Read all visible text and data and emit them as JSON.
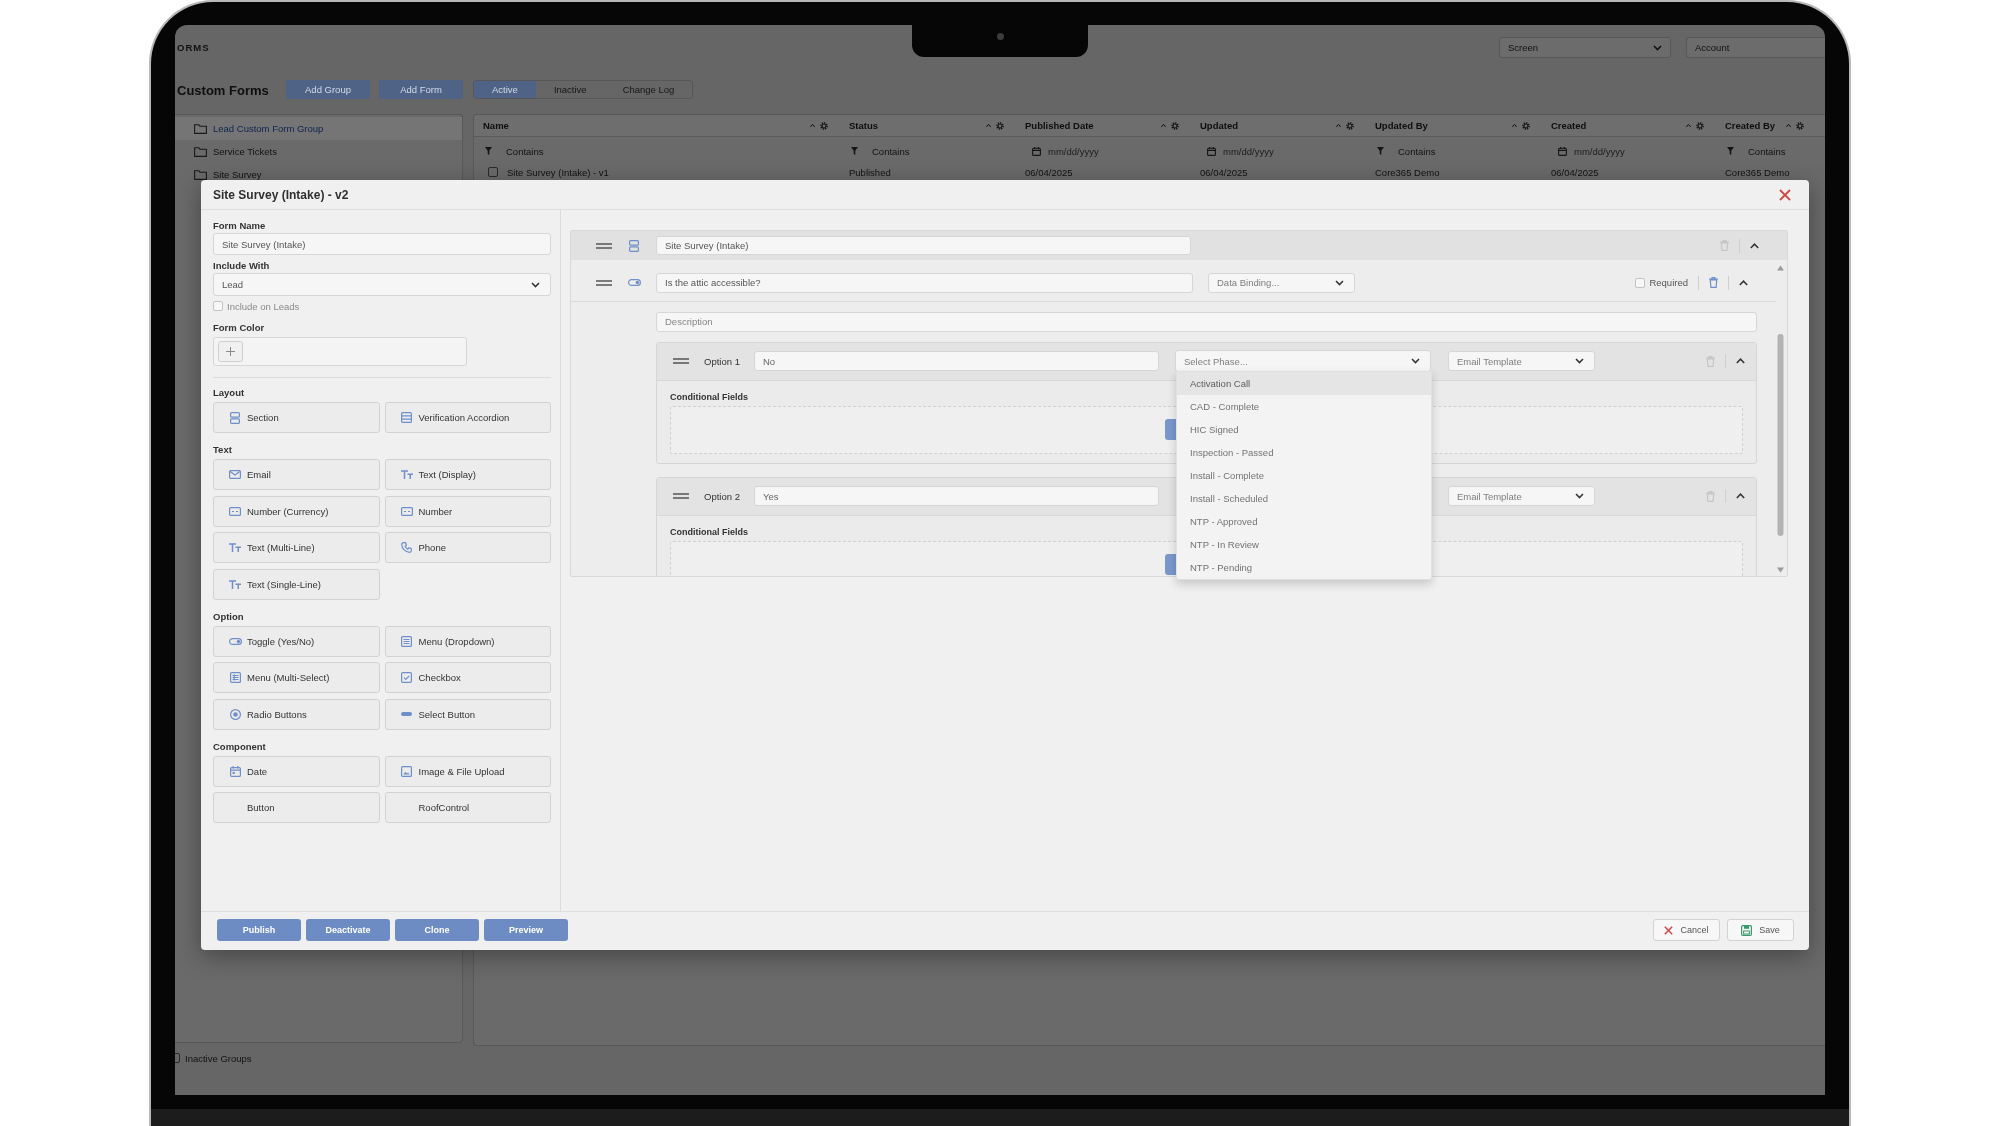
{
  "background_app": {
    "header": {
      "title": "ORMS",
      "screen_select": {
        "value": "Screen"
      },
      "account_field": {
        "placeholder": "Account"
      }
    },
    "page_title": "Custom Forms",
    "actions": [
      "Add Group",
      "Add Form"
    ],
    "tabs": [
      {
        "label": "Active",
        "selected": true
      },
      {
        "label": "Inactive",
        "selected": false
      },
      {
        "label": "Change Log",
        "selected": false
      }
    ],
    "sidebar": {
      "groups": [
        {
          "label": "Lead Custom Form Group",
          "selected": true
        },
        {
          "label": "Service Tickets",
          "selected": false
        },
        {
          "label": "Site Survey",
          "selected": false
        }
      ],
      "inactive_groups": {
        "label": "Inactive Groups",
        "checked": false
      }
    },
    "table": {
      "columns": [
        {
          "label": "Name",
          "filter": {
            "kind": "text",
            "placeholder": "Contains"
          }
        },
        {
          "label": "Status",
          "filter": {
            "kind": "text",
            "placeholder": "Contains"
          }
        },
        {
          "label": "Published Date",
          "filter": {
            "kind": "date",
            "placeholder": "mm/dd/yyyy"
          }
        },
        {
          "label": "Updated",
          "filter": {
            "kind": "date",
            "placeholder": "mm/dd/yyyy"
          }
        },
        {
          "label": "Updated By",
          "filter": {
            "kind": "text",
            "placeholder": "Contains"
          }
        },
        {
          "label": "Created",
          "filter": {
            "kind": "date",
            "placeholder": "mm/dd/yyyy"
          }
        },
        {
          "label": "Created By",
          "filter": {
            "kind": "text",
            "placeholder": "Contains"
          }
        }
      ],
      "rows": [
        {
          "checked": false,
          "cells": [
            "Site Survey (Intake) - v1",
            "Published",
            "06/04/2025",
            "06/04/2025",
            "Core365 Demo",
            "06/04/2025",
            "Core365 Demo"
          ]
        }
      ]
    }
  },
  "dialog": {
    "title": "Site Survey (Intake) - v2",
    "form_name": {
      "label": "Form Name",
      "value": "Site Survey (Intake)"
    },
    "include_with": {
      "label": "Include With",
      "value": "Lead"
    },
    "include_on_leads": {
      "label": "Include on Leads",
      "checked": false,
      "disabled": true
    },
    "form_color": {
      "label": "Form Color"
    },
    "palette": [
      {
        "heading": "Layout",
        "items": [
          {
            "label": "Section",
            "kind": "section"
          },
          {
            "label": "Verification Accordion",
            "kind": "accordion"
          }
        ]
      },
      {
        "heading": "Text",
        "items": [
          {
            "label": "Email",
            "kind": "email"
          },
          {
            "label": "Text (Display)",
            "kind": "text"
          },
          {
            "label": "Number (Currency)",
            "kind": "currency"
          },
          {
            "label": "Number",
            "kind": "number"
          },
          {
            "label": "Text (Multi-Line)",
            "kind": "text"
          },
          {
            "label": "Phone",
            "kind": "phone"
          },
          {
            "label": "Text (Single-Line)",
            "kind": "text"
          }
        ]
      },
      {
        "heading": "Option",
        "items": [
          {
            "label": "Toggle (Yes/No)",
            "kind": "toggle"
          },
          {
            "label": "Menu (Dropdown)",
            "kind": "dropdown"
          },
          {
            "label": "Menu (Multi-Select)",
            "kind": "multiselect"
          },
          {
            "label": "Checkbox",
            "kind": "checkbox"
          },
          {
            "label": "Radio Buttons",
            "kind": "radio"
          },
          {
            "label": "Select Button",
            "kind": "select_button"
          }
        ]
      },
      {
        "heading": "Component",
        "items": [
          {
            "label": "Date",
            "kind": "date"
          },
          {
            "label": "Image & File Upload",
            "kind": "upload"
          },
          {
            "label": "Button",
            "kind": "button"
          },
          {
            "label": "RoofControl",
            "kind": "roof"
          }
        ]
      }
    ],
    "builder": {
      "section": {
        "title": "Site Survey (Intake)",
        "can_delete": false,
        "expanded": true
      },
      "field": {
        "kind": "toggle",
        "question": "Is the attic accessible?",
        "data_binding": {
          "placeholder": "Data Binding..."
        },
        "required": {
          "label": "Required",
          "checked": false
        },
        "can_delete": true,
        "expanded": true,
        "description": {
          "placeholder": "Description"
        },
        "options": [
          {
            "label": "Option 1",
            "value": "No",
            "phase_select": {
              "placeholder": "Select Phase...",
              "open": true,
              "options": [
                {
                  "label": "Activation Call",
                  "selected": true
                },
                {
                  "label": "CAD - Complete",
                  "selected": false
                },
                {
                  "label": "HIC Signed",
                  "selected": false
                },
                {
                  "label": "Inspection - Passed",
                  "selected": false
                },
                {
                  "label": "Install - Complete",
                  "selected": false
                },
                {
                  "label": "Install - Scheduled",
                  "selected": false
                },
                {
                  "label": "NTP - Approved",
                  "selected": false
                },
                {
                  "label": "NTP - In Review",
                  "selected": false
                },
                {
                  "label": "NTP - Pending",
                  "selected": false
                }
              ]
            },
            "email_template": {
              "placeholder": "Email Template"
            },
            "can_delete": false,
            "expanded": true,
            "conditional_fields": "Conditional Fields"
          },
          {
            "label": "Option 2",
            "value": "Yes",
            "email_template": {
              "placeholder": "Email Template"
            },
            "can_delete": false,
            "expanded": true,
            "conditional_fields": "Conditional Fields"
          }
        ]
      }
    },
    "footer": {
      "actions": [
        "Publish",
        "Deactivate",
        "Clone",
        "Preview"
      ],
      "cancel": "Cancel",
      "save": "Save"
    }
  }
}
